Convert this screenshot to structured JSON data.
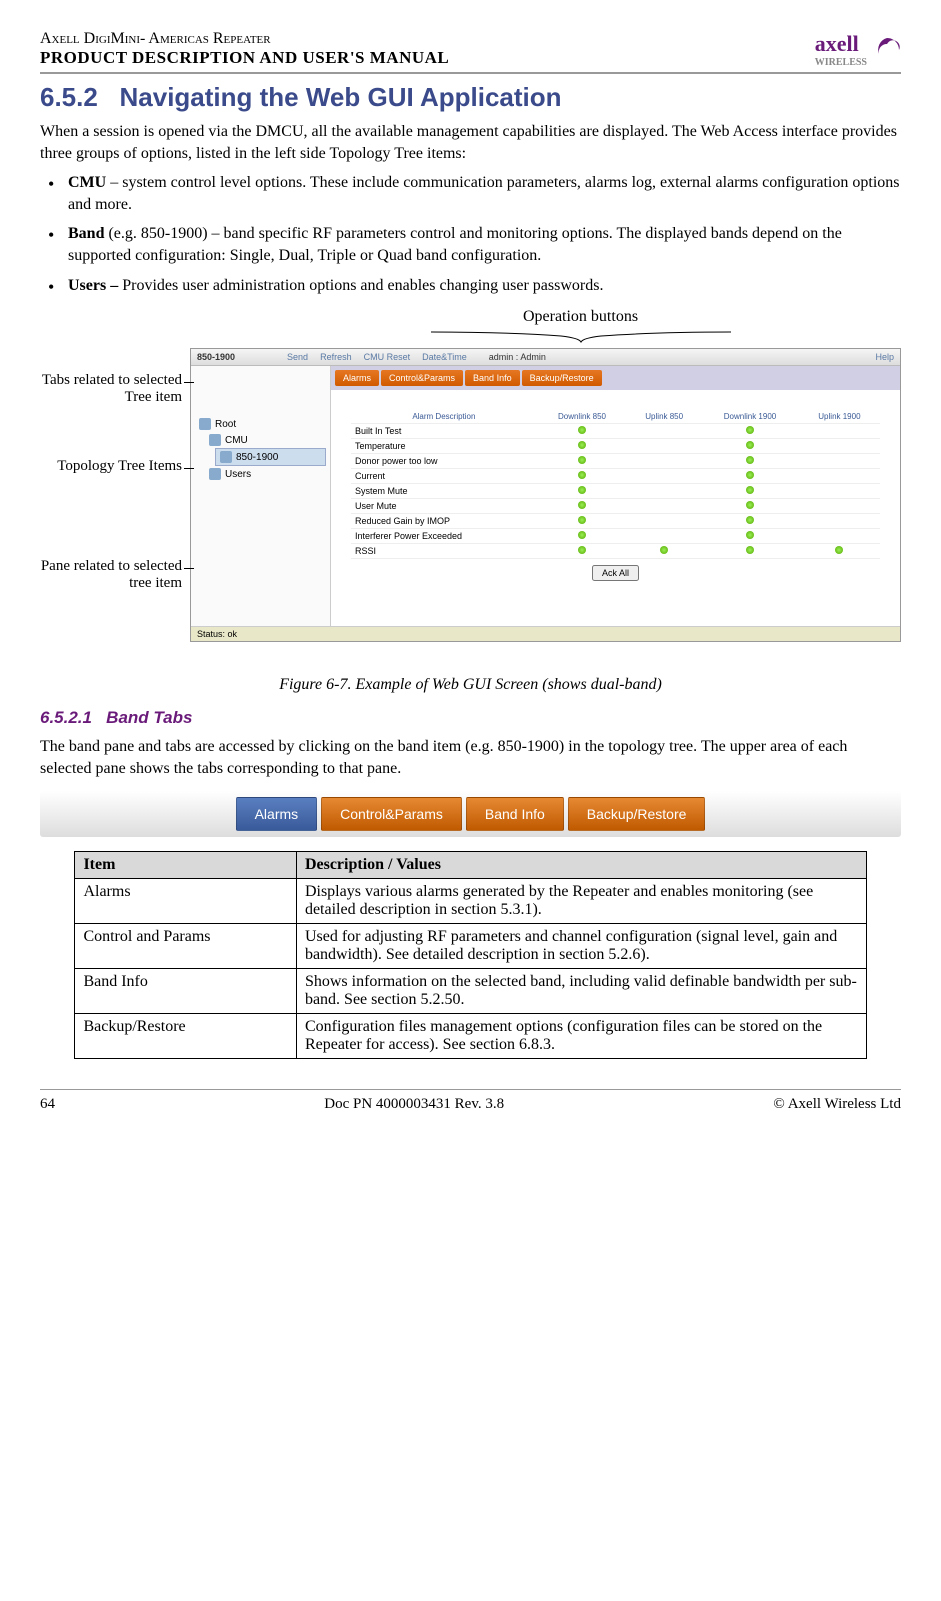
{
  "header": {
    "title_line1": "Axell DigiMini- Americas Repeater",
    "title_line2": "PRODUCT DESCRIPTION AND USER'S MANUAL",
    "logo_text": "axell",
    "logo_sub": "WIRELESS"
  },
  "section": {
    "number": "6.5.2",
    "title": "Navigating the Web GUI Application",
    "intro": "When a session is opened via the DMCU, all the available management capabilities are displayed. The Web Access interface provides three groups of options, listed in the left side Topology Tree items:",
    "bullets": [
      {
        "term": "CMU",
        "text": " – system control level options. These include communication parameters, alarms log, external alarms configuration options and more."
      },
      {
        "term": "Band",
        "text": " (e.g. 850-1900) –  band specific RF parameters control and monitoring options. The displayed bands depend on the supported configuration: Single, Dual, Triple or Quad band configuration."
      },
      {
        "term": "Users –",
        "text": " Provides user administration options and enables changing user passwords."
      }
    ]
  },
  "figure": {
    "op_buttons_label": "Operation buttons",
    "callouts": {
      "tabs": "Tabs related to selected Tree item",
      "tree": "Topology Tree Items",
      "pane": "Pane related to selected tree item"
    },
    "caption": "Figure 6-7. Example of Web GUI Screen (shows dual-band)"
  },
  "screenshot": {
    "band_title": "850-1900",
    "top_buttons": [
      "Send",
      "Refresh",
      "CMU Reset",
      "Date&Time"
    ],
    "admin_text": "admin : Admin",
    "help_text": "Help",
    "tabs": [
      "Alarms",
      "Control&Params",
      "Band Info",
      "Backup/Restore"
    ],
    "tree": [
      "Root",
      "CMU",
      "850-1900",
      "Users"
    ],
    "table": {
      "head": [
        "Alarm Description",
        "Downlink 850",
        "Uplink 850",
        "Downlink 1900",
        "Uplink 1900"
      ],
      "rows": [
        {
          "name": "Built In Test",
          "dots": [
            1,
            0,
            1,
            0
          ]
        },
        {
          "name": "Temperature",
          "dots": [
            1,
            0,
            1,
            0
          ]
        },
        {
          "name": "Donor power too low",
          "dots": [
            1,
            0,
            1,
            0
          ]
        },
        {
          "name": "Current",
          "dots": [
            1,
            0,
            1,
            0
          ]
        },
        {
          "name": "System Mute",
          "dots": [
            1,
            0,
            1,
            0
          ]
        },
        {
          "name": "User Mute",
          "dots": [
            1,
            0,
            1,
            0
          ]
        },
        {
          "name": "Reduced Gain by IMOP",
          "dots": [
            1,
            0,
            1,
            0
          ]
        },
        {
          "name": "Interferer Power Exceeded",
          "dots": [
            1,
            0,
            1,
            0
          ]
        },
        {
          "name": "RSSI",
          "dots": [
            1,
            1,
            1,
            1
          ]
        }
      ]
    },
    "ack_all": "Ack All",
    "status": "Status: ok"
  },
  "subsection": {
    "number": "6.5.2.1",
    "title": "Band Tabs",
    "text": "The band pane and tabs are accessed by clicking on the band item (e.g. 850-1900) in the topology tree. The upper area of each selected pane shows the tabs corresponding to that pane."
  },
  "band_tabs_img": [
    "Alarms",
    "Control&Params",
    "Band Info",
    "Backup/Restore"
  ],
  "desc_table": {
    "head": [
      "Item",
      "Description / Values"
    ],
    "rows": [
      {
        "item": "Alarms",
        "desc": "Displays various alarms generated by the Repeater and enables monitoring (see detailed description in section 5.3.1)."
      },
      {
        "item": "Control and Params",
        "desc": "Used for adjusting RF parameters and channel configuration (signal level, gain and bandwidth). See detailed description in section 5.2.6)."
      },
      {
        "item": "Band Info",
        "desc": "Shows information on the selected band, including valid definable bandwidth per sub-band. See section 5.2.50."
      },
      {
        "item": "Backup/Restore",
        "desc": "Configuration files management options (configuration files can be stored on the Repeater for access). See section 6.8.3."
      }
    ]
  },
  "footer": {
    "page": "64",
    "doc": "Doc PN 4000003431 Rev. 3.8",
    "copyright": "© Axell Wireless Ltd"
  }
}
